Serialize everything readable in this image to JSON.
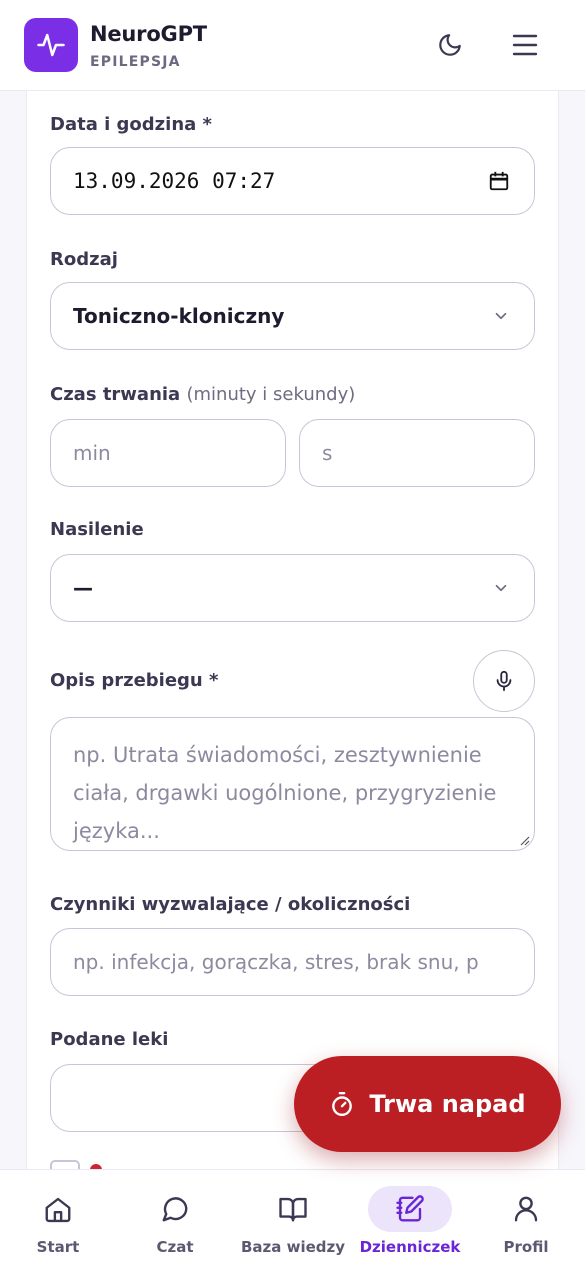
{
  "header": {
    "brand_name": "NeuroGPT",
    "brand_sub": "EPILEPSJA",
    "brand_color": "#7a2fe6"
  },
  "form": {
    "datetime": {
      "label": "Data i godzina *",
      "value": "13.09.2026 07:27"
    },
    "type": {
      "label": "Rodzaj",
      "value": "Toniczno-kloniczny"
    },
    "duration": {
      "label": "Czas trwania",
      "hint": "(minuty i sekundy)",
      "min_placeholder": "min",
      "sec_placeholder": "s"
    },
    "severity": {
      "label": "Nasilenie",
      "value": "—"
    },
    "description": {
      "label": "Opis przebiegu *",
      "placeholder": "np. Utrata świadomości, zesztywnienie ciała, drgawki uogólnione, przygryzienie języka..."
    },
    "triggers": {
      "label": "Czynniki wyzwalające / okoliczności",
      "placeholder": "np. infekcja, gorączka, stres, brak snu, p"
    },
    "meds": {
      "label": "Podane leki",
      "placeholder": ""
    }
  },
  "fab": {
    "label": "Trwa napad",
    "color": "#bb1f24"
  },
  "nav": {
    "items": [
      {
        "label": "Start",
        "icon": "home-icon"
      },
      {
        "label": "Czat",
        "icon": "chat-bubble-icon"
      },
      {
        "label": "Baza wiedzy",
        "icon": "book-icon"
      },
      {
        "label": "Dzienniczek",
        "icon": "journal-edit-icon",
        "active": true
      },
      {
        "label": "Profil",
        "icon": "user-icon"
      }
    ],
    "active_color": "#6a25d6"
  }
}
